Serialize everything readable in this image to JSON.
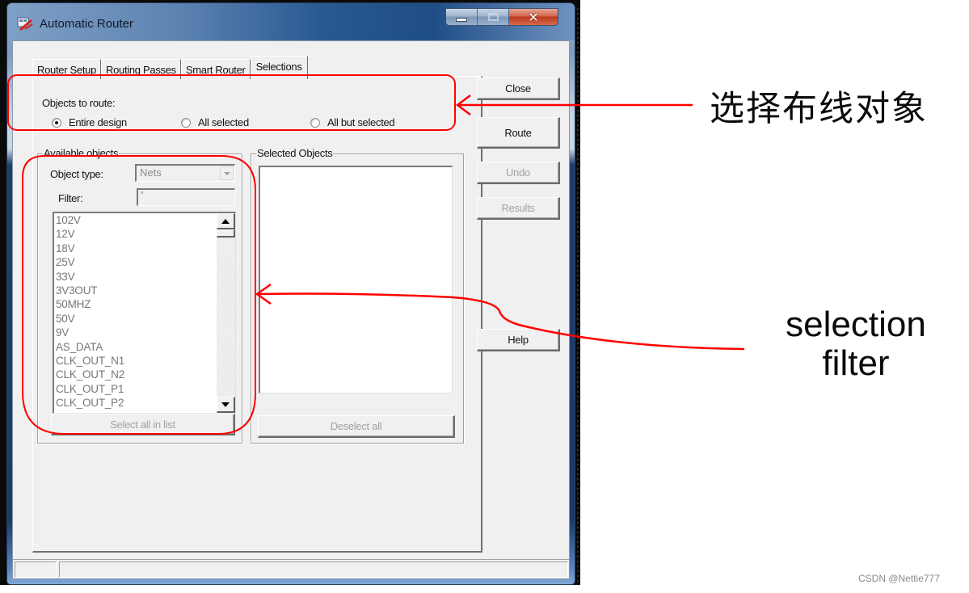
{
  "window": {
    "title": "Automatic Router",
    "controls": {
      "minimize": "minimize",
      "maximize": "maximize",
      "close": "close"
    }
  },
  "tabs": [
    {
      "label": "Router Setup",
      "active": false
    },
    {
      "label": "Routing Passes",
      "active": false
    },
    {
      "label": "Smart Router",
      "active": false
    },
    {
      "label": "Selections",
      "active": true
    }
  ],
  "objects_to_route": {
    "label": "Objects to route:",
    "options": [
      {
        "label": "Entire design",
        "checked": true
      },
      {
        "label": "All selected",
        "checked": false
      },
      {
        "label": "All but selected",
        "checked": false
      }
    ]
  },
  "available_objects": {
    "title": "Available objects",
    "object_type_label": "Object type:",
    "object_type_value": "Nets",
    "filter_label": "Filter:",
    "filter_value": "*",
    "items": [
      "102V",
      "12V",
      "18V",
      "25V",
      "33V",
      "3V3OUT",
      "50MHZ",
      "50V",
      "9V",
      "AS_DATA",
      "CLK_OUT_N1",
      "CLK_OUT_N2",
      "CLK_OUT_P1",
      "CLK_OUT_P2"
    ],
    "select_all_label": "Select all in list"
  },
  "selected_objects": {
    "title": "Selected Objects",
    "items": [],
    "deselect_all_label": "Deselect all"
  },
  "side_buttons": {
    "close": "Close",
    "route": "Route",
    "undo": "Undo",
    "results": "Results",
    "help": "Help"
  },
  "annotations": {
    "objects_callout": "选择布线对象",
    "filter_callout_line1": "selection",
    "filter_callout_line2": "filter",
    "color": "#ff0000"
  },
  "watermark": "CSDN @Nettie777"
}
